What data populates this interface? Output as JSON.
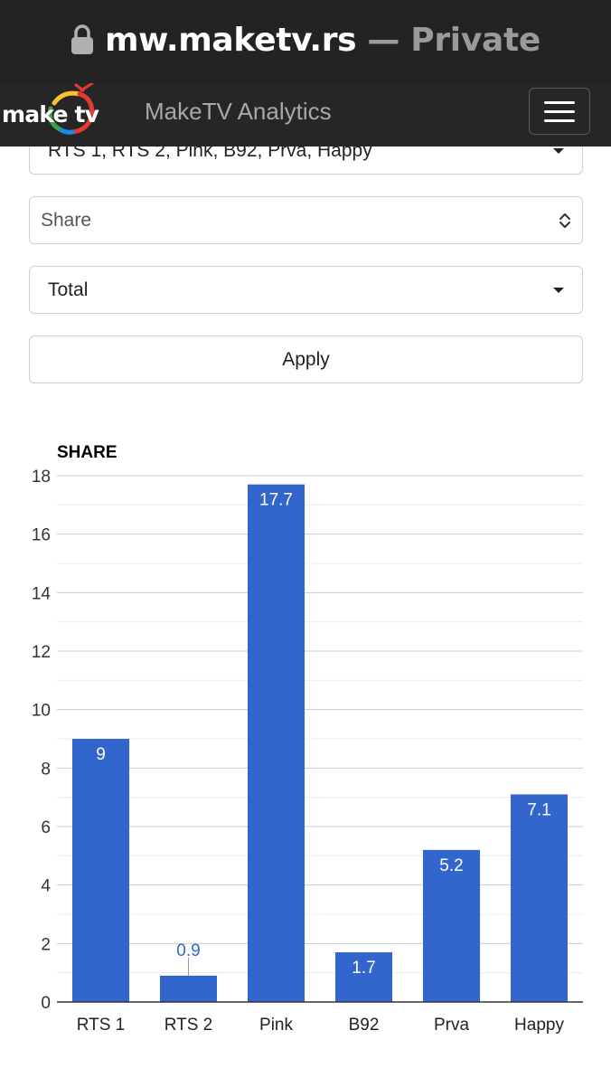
{
  "browser": {
    "host": "mw.maketv.rs",
    "mode": "— Private",
    "lock_icon": "lock-icon"
  },
  "navbar": {
    "logo_text": "make tv",
    "title": "MakeTV Analytics",
    "menu_icon": "hamburger-menu-icon"
  },
  "filters": {
    "channels_value": "RTS 1, RTS 2, Pink, B92, Prva, Happy",
    "metric_value": "Share",
    "period_value": "Total",
    "apply_label": "Apply"
  },
  "colors": {
    "bar": "#3366cc",
    "browser_bg": "#232323",
    "navbar_bg": "#262626"
  },
  "chart_data": {
    "type": "bar",
    "title": "SHARE",
    "categories": [
      "RTS 1",
      "RTS 2",
      "Pink",
      "B92",
      "Prva",
      "Happy"
    ],
    "values": [
      9,
      0.9,
      17.7,
      1.7,
      5.2,
      7.1
    ],
    "data_labels": [
      "9",
      "0.9",
      "17.7",
      "1.7",
      "5.2",
      "7.1"
    ],
    "ylim": [
      0,
      18
    ],
    "yticks": [
      0,
      2,
      4,
      6,
      8,
      10,
      12,
      14,
      16,
      18
    ],
    "ytick_labels": [
      "0",
      "2",
      "4",
      "6",
      "8",
      "10",
      "12",
      "14",
      "16",
      "18"
    ],
    "minor_grid_step": 1,
    "grid": true,
    "legend": "none"
  }
}
